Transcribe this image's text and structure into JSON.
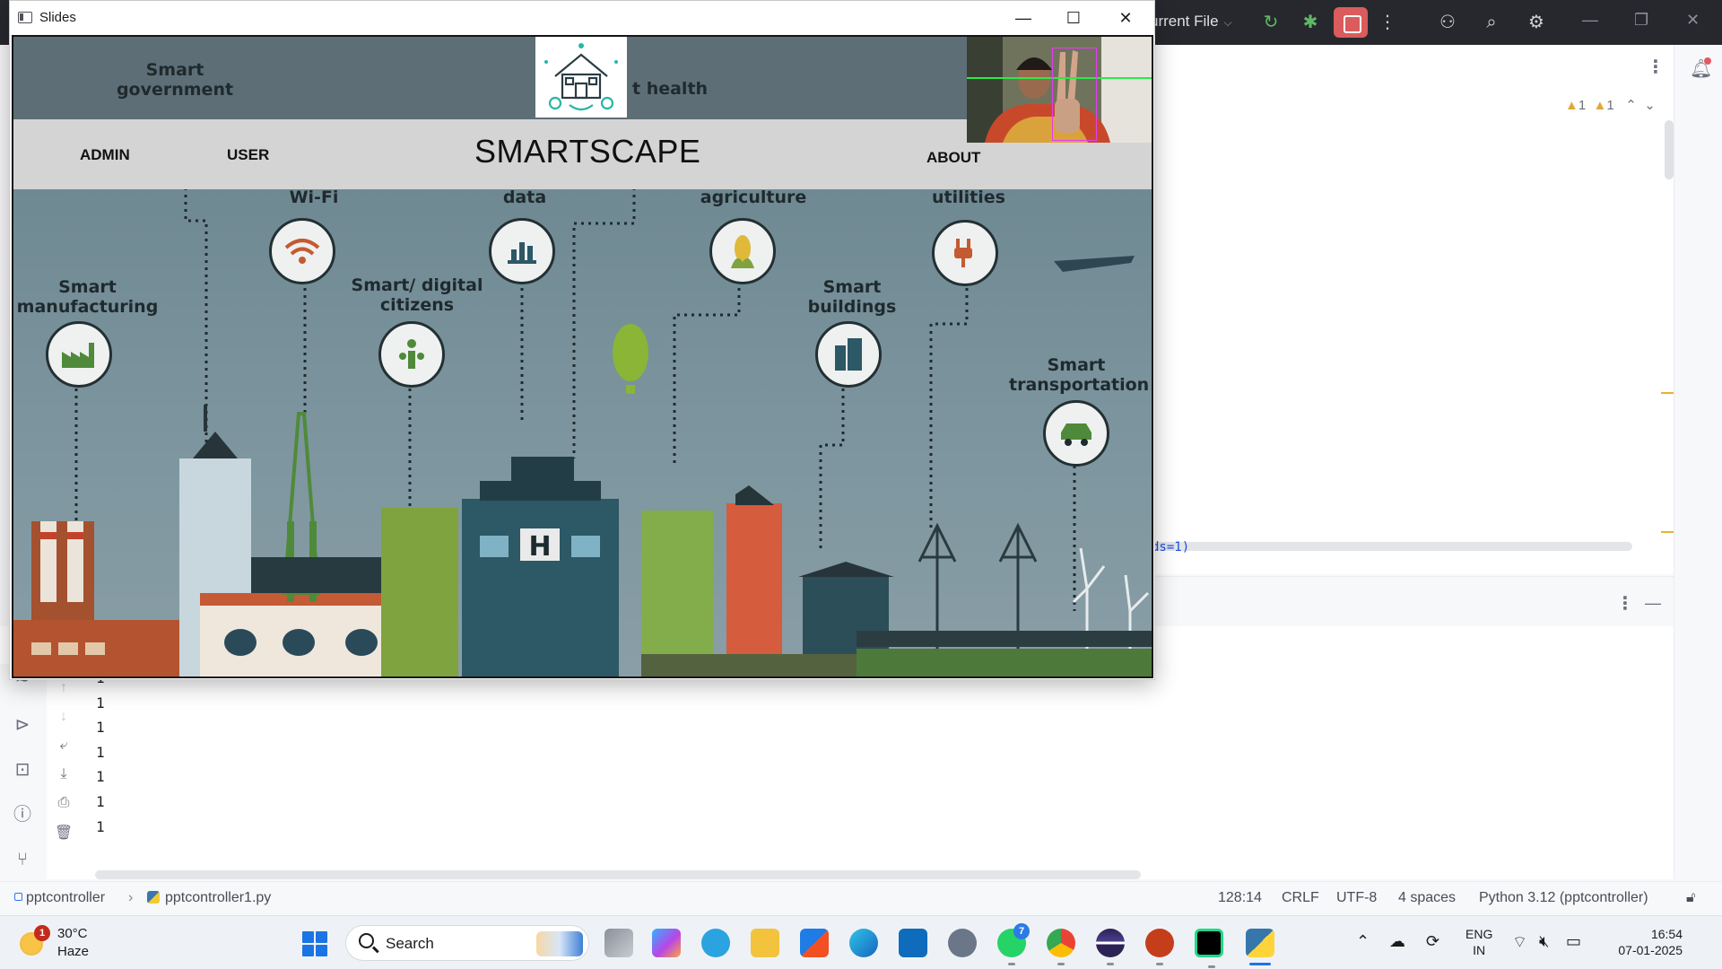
{
  "ide": {
    "run_config": "urrent File",
    "breadcrumb": {
      "project": "pptcontroller",
      "file": "pptcontroller1.py"
    },
    "warnings": {
      "count_a": "1",
      "count_b": "1"
    },
    "code_fragment": "ds=1)",
    "console": [
      "1",
      "1",
      "1",
      "1",
      "1",
      "1",
      "1"
    ],
    "status": {
      "position": "128:14",
      "line_ending": "CRLF",
      "encoding": "UTF-8",
      "indent": "4 spaces",
      "interpreter": "Python 3.12 (pptcontroller)"
    },
    "colors": {
      "toolbar": "#27282e",
      "stop": "#db5c5c",
      "run": "#5fb865"
    }
  },
  "slides_window": {
    "title": "Slides",
    "nav": {
      "admin": "ADMIN",
      "user": "USER",
      "brand": "SMARTSCAPE",
      "about": "ABOUT"
    },
    "scene_labels": {
      "government": "Smart government",
      "health": "t health",
      "wifi": "Wi-Fi",
      "data": "data",
      "agriculture": "agriculture",
      "utilities": "utilities",
      "manufacturing": "Smart manufacturing",
      "citizens": "Smart/ digital citizens",
      "buildings": "Smart buildings",
      "transportation": "Smart transportation"
    }
  },
  "taskbar": {
    "weather": {
      "temp": "30°C",
      "condition": "Haze",
      "badge": "1"
    },
    "search_label": "Search",
    "apps": [
      "task-view",
      "copilot",
      "telegram",
      "file-explorer",
      "microsoft-store",
      "edge",
      "outlook",
      "settings",
      "whatsapp",
      "chrome",
      "eclipse",
      "powerpoint",
      "pycharm",
      "python"
    ],
    "whatsapp_badge": "7",
    "language": {
      "line1": "ENG",
      "line2": "IN"
    },
    "clock": {
      "time": "16:54",
      "date": "07-01-2025"
    }
  }
}
